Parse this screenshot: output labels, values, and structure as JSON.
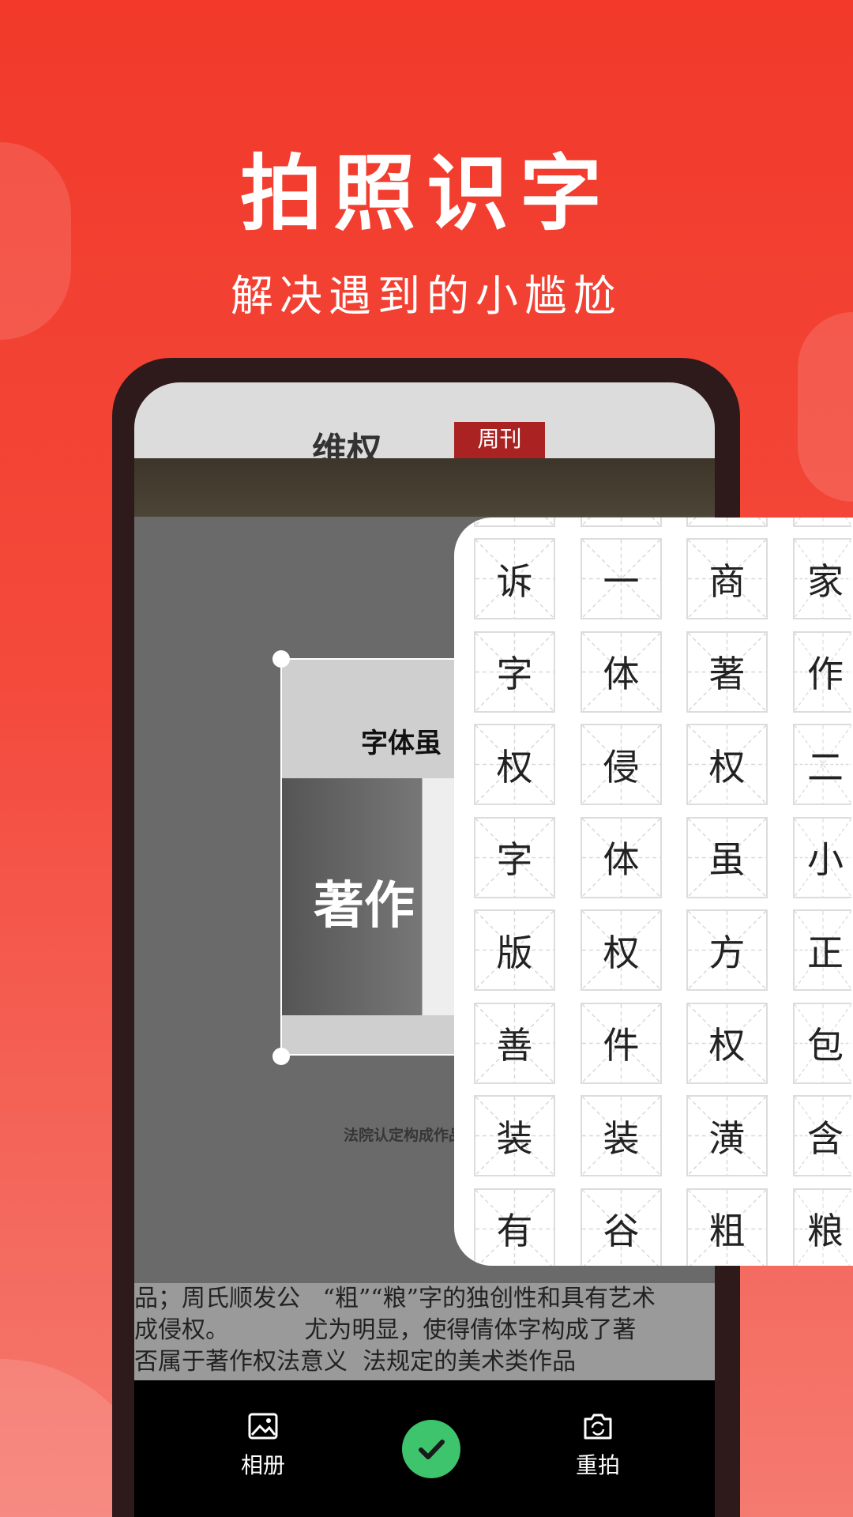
{
  "header": {
    "title": "拍照识字",
    "subtitle": "解决遇到的小尴尬"
  },
  "photo": {
    "masthead": "维权",
    "masthead_badge": "周刊",
    "headline": "字体虽",
    "big_text": "著作",
    "bottom_lines": [
      "品；周氏顺发公   “粗”“粮”字的独创性和具有艺术",
      "成侵权。          尤为明显，使得倩体字构成了著",
      "否属于著作权法意义  法规定的美术类作品"
    ],
    "section_title": "法院认定构成作品"
  },
  "result_grid": {
    "rows": [
      [
        "诉",
        "一",
        "商",
        "家"
      ],
      [
        "字",
        "体",
        "著",
        "作"
      ],
      [
        "权",
        "侵",
        "权",
        "二"
      ],
      [
        "字",
        "体",
        "虽",
        "小"
      ],
      [
        "版",
        "权",
        "方",
        "正"
      ],
      [
        "善",
        "件",
        "权",
        "包"
      ],
      [
        "装",
        "装",
        "潢",
        "含"
      ],
      [
        "有",
        "谷",
        "粗",
        "粮"
      ]
    ]
  },
  "toolbar": {
    "album_label": "相册",
    "retake_label": "重拍",
    "confirm_icon": "check-icon",
    "accent": "#3ec46d"
  },
  "colors": {
    "background": "#f2392a",
    "phone_frame": "#2e1a1a"
  }
}
